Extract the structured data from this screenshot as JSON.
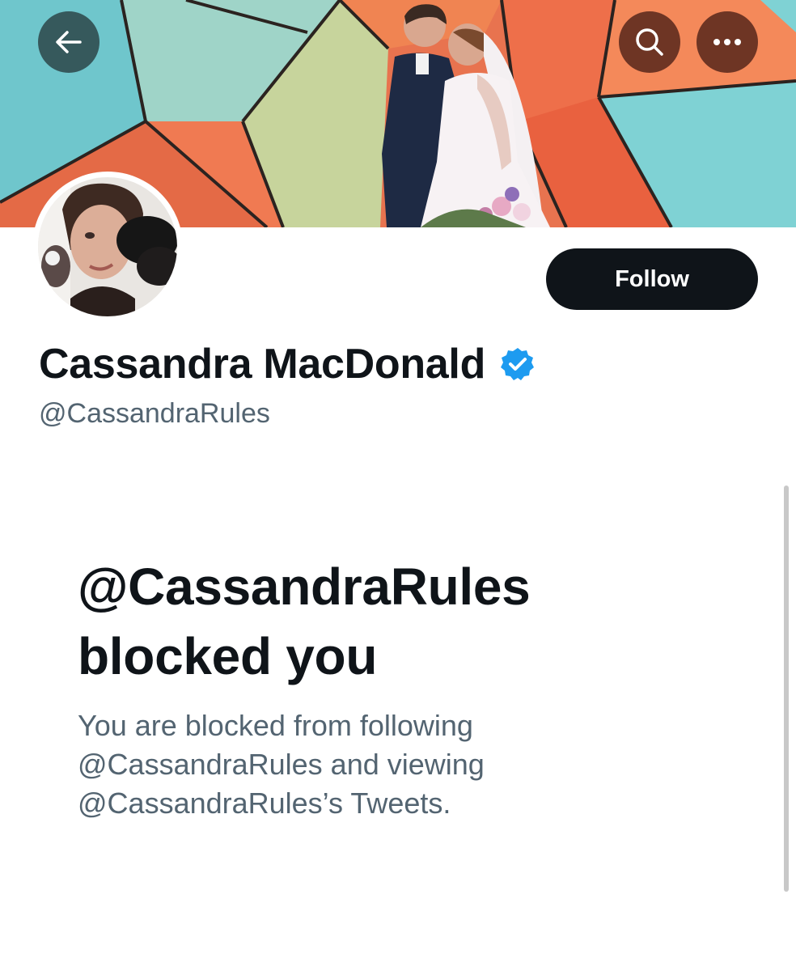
{
  "header": {
    "back_icon": "arrow-left-icon",
    "search_icon": "search-icon",
    "more_icon": "more-horizontal-icon"
  },
  "profile": {
    "display_name": "Cassandra MacDonald",
    "handle": "@CassandraRules",
    "verified": true,
    "follow_label": "Follow"
  },
  "blocked": {
    "title_line1": "@CassandraRules",
    "title_line2": "blocked you",
    "desc_line1": "You are blocked from following",
    "desc_line2": "@CassandraRules and viewing",
    "desc_line3": "@CassandraRules’s Tweets."
  },
  "colors": {
    "text_primary": "#0f1419",
    "text_secondary": "#536471",
    "verified_blue": "#1d9bf0",
    "follow_button_bg": "#0f1419"
  }
}
